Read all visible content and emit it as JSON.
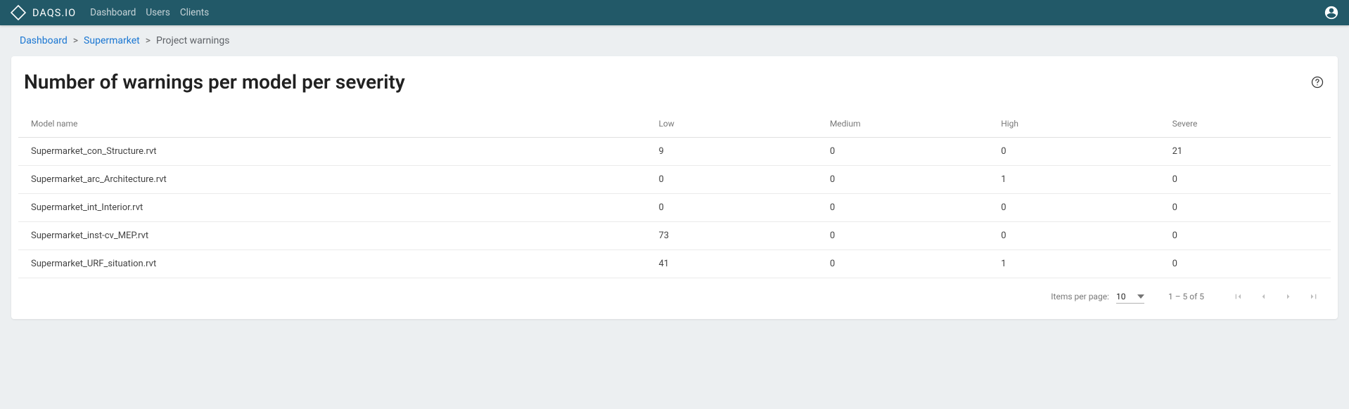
{
  "header": {
    "brand": "DAQS.IO",
    "nav": [
      "Dashboard",
      "Users",
      "Clients"
    ]
  },
  "breadcrumb": {
    "items": [
      {
        "label": "Dashboard",
        "link": true,
        "current": false
      },
      {
        "label": "Supermarket",
        "link": true,
        "current": false
      },
      {
        "label": "Project warnings",
        "link": false,
        "current": true
      }
    ]
  },
  "card": {
    "title": "Number of warnings per model per severity"
  },
  "table": {
    "columns": [
      "Model name",
      "Low",
      "Medium",
      "High",
      "Severe"
    ],
    "rows": [
      {
        "model": "Supermarket_con_Structure.rvt",
        "low": "9",
        "medium": "0",
        "high": "0",
        "severe": "21"
      },
      {
        "model": "Supermarket_arc_Architecture.rvt",
        "low": "0",
        "medium": "0",
        "high": "1",
        "severe": "0"
      },
      {
        "model": "Supermarket_int_Interior.rvt",
        "low": "0",
        "medium": "0",
        "high": "0",
        "severe": "0"
      },
      {
        "model": "Supermarket_inst-cv_MEP.rvt",
        "low": "73",
        "medium": "0",
        "high": "0",
        "severe": "0"
      },
      {
        "model": "Supermarket_URF_situation.rvt",
        "low": "41",
        "medium": "0",
        "high": "1",
        "severe": "0"
      }
    ]
  },
  "paginator": {
    "items_per_page_label": "Items per page:",
    "items_per_page_value": "10",
    "range_label": "1 – 5 of 5"
  }
}
